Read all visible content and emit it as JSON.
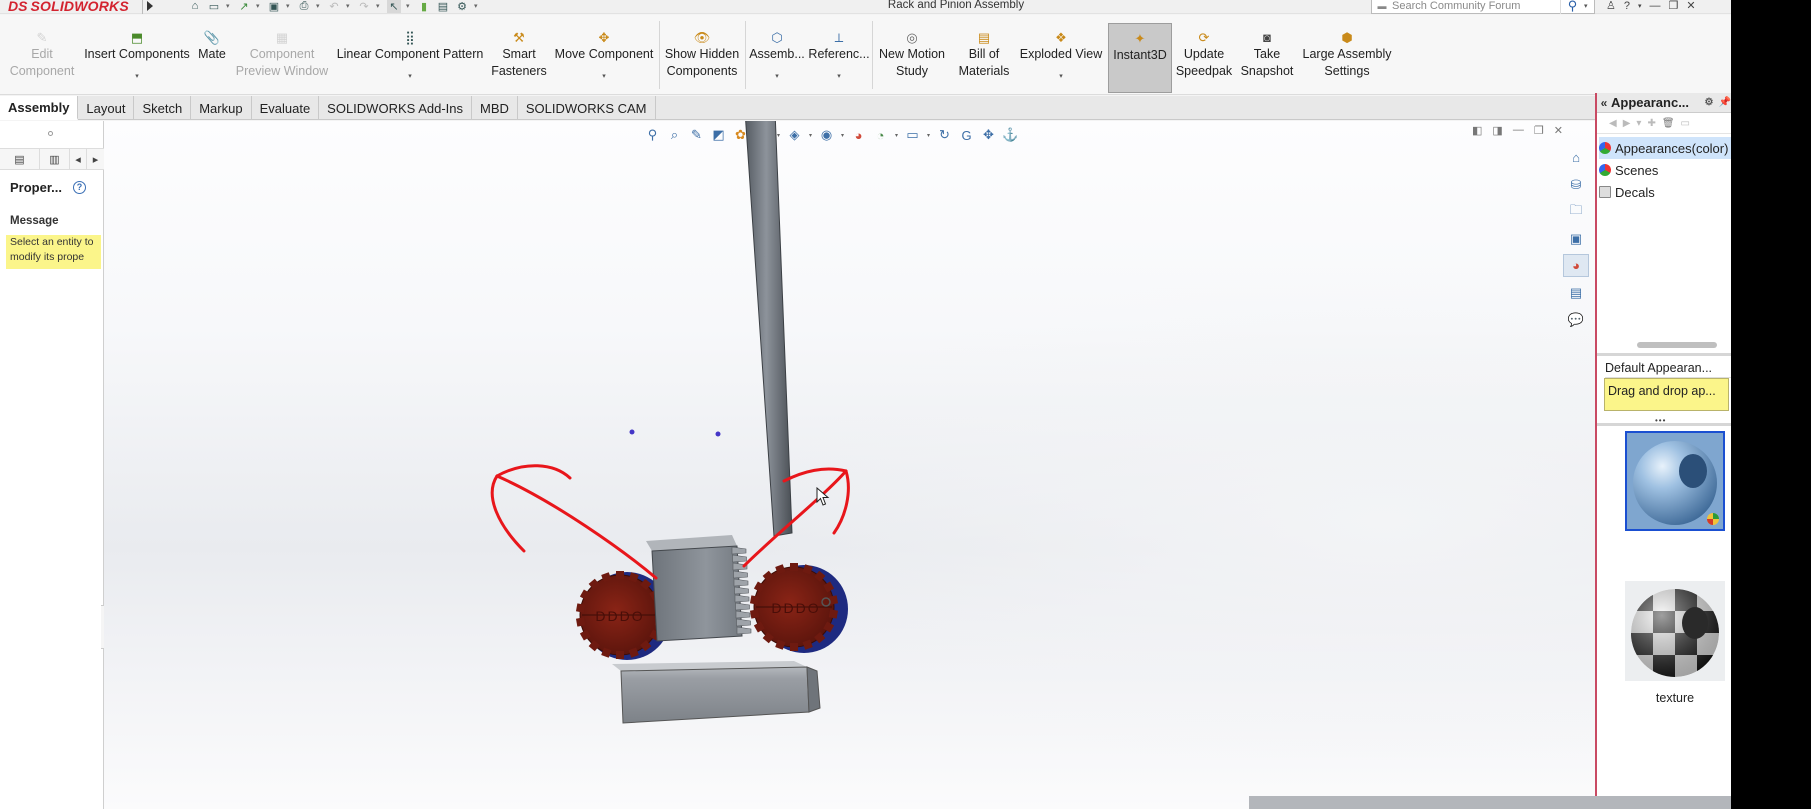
{
  "app": {
    "logo_ds": "DS",
    "logo_name": "SOLIDWORKS",
    "document_title": "Rack and Pinion Assembly",
    "search_placeholder": "Search Community Forum"
  },
  "commands": {
    "edit_component": [
      "Edit",
      "Component"
    ],
    "insert_components": "Insert Components",
    "mate": "Mate",
    "component_preview": [
      "Component",
      "Preview Window"
    ],
    "linear_pattern": "Linear Component Pattern",
    "smart_fasteners": [
      "Smart",
      "Fasteners"
    ],
    "move_component": "Move Component",
    "show_hidden": [
      "Show Hidden",
      "Components"
    ],
    "assembly_features": "Assemb...",
    "reference_geometry": "Referenc...",
    "new_motion_study": [
      "New Motion",
      "Study"
    ],
    "bill_of_materials": [
      "Bill of",
      "Materials"
    ],
    "exploded_view": "Exploded View",
    "instant3d": "Instant3D",
    "update_speedpak": [
      "Update",
      "Speedpak"
    ],
    "take_snapshot": [
      "Take",
      "Snapshot"
    ],
    "large_assembly": [
      "Large Assembly",
      "Settings"
    ]
  },
  "tabs": [
    "Assembly",
    "Layout",
    "Sketch",
    "Markup",
    "Evaluate",
    "SOLIDWORKS Add-Ins",
    "MBD",
    "SOLIDWORKS CAM"
  ],
  "property_manager": {
    "title": "Proper...",
    "message_heading": "Message",
    "message_line1": "Select an entity to",
    "message_line2": "modify its prope"
  },
  "task_pane": {
    "title": "Appearanc...",
    "tree": [
      "Appearances(color)",
      "Scenes",
      "Decals"
    ],
    "default_label": "Default Appearan...",
    "drag_hint": "Drag and drop ap...",
    "thumbnail_label": "texture"
  },
  "colors": {
    "brand": "#d3232f",
    "gear": "#7a1a12",
    "annotation": "#e8161b",
    "highlight": "#fbf58a",
    "selection": "#1a4fd1"
  }
}
